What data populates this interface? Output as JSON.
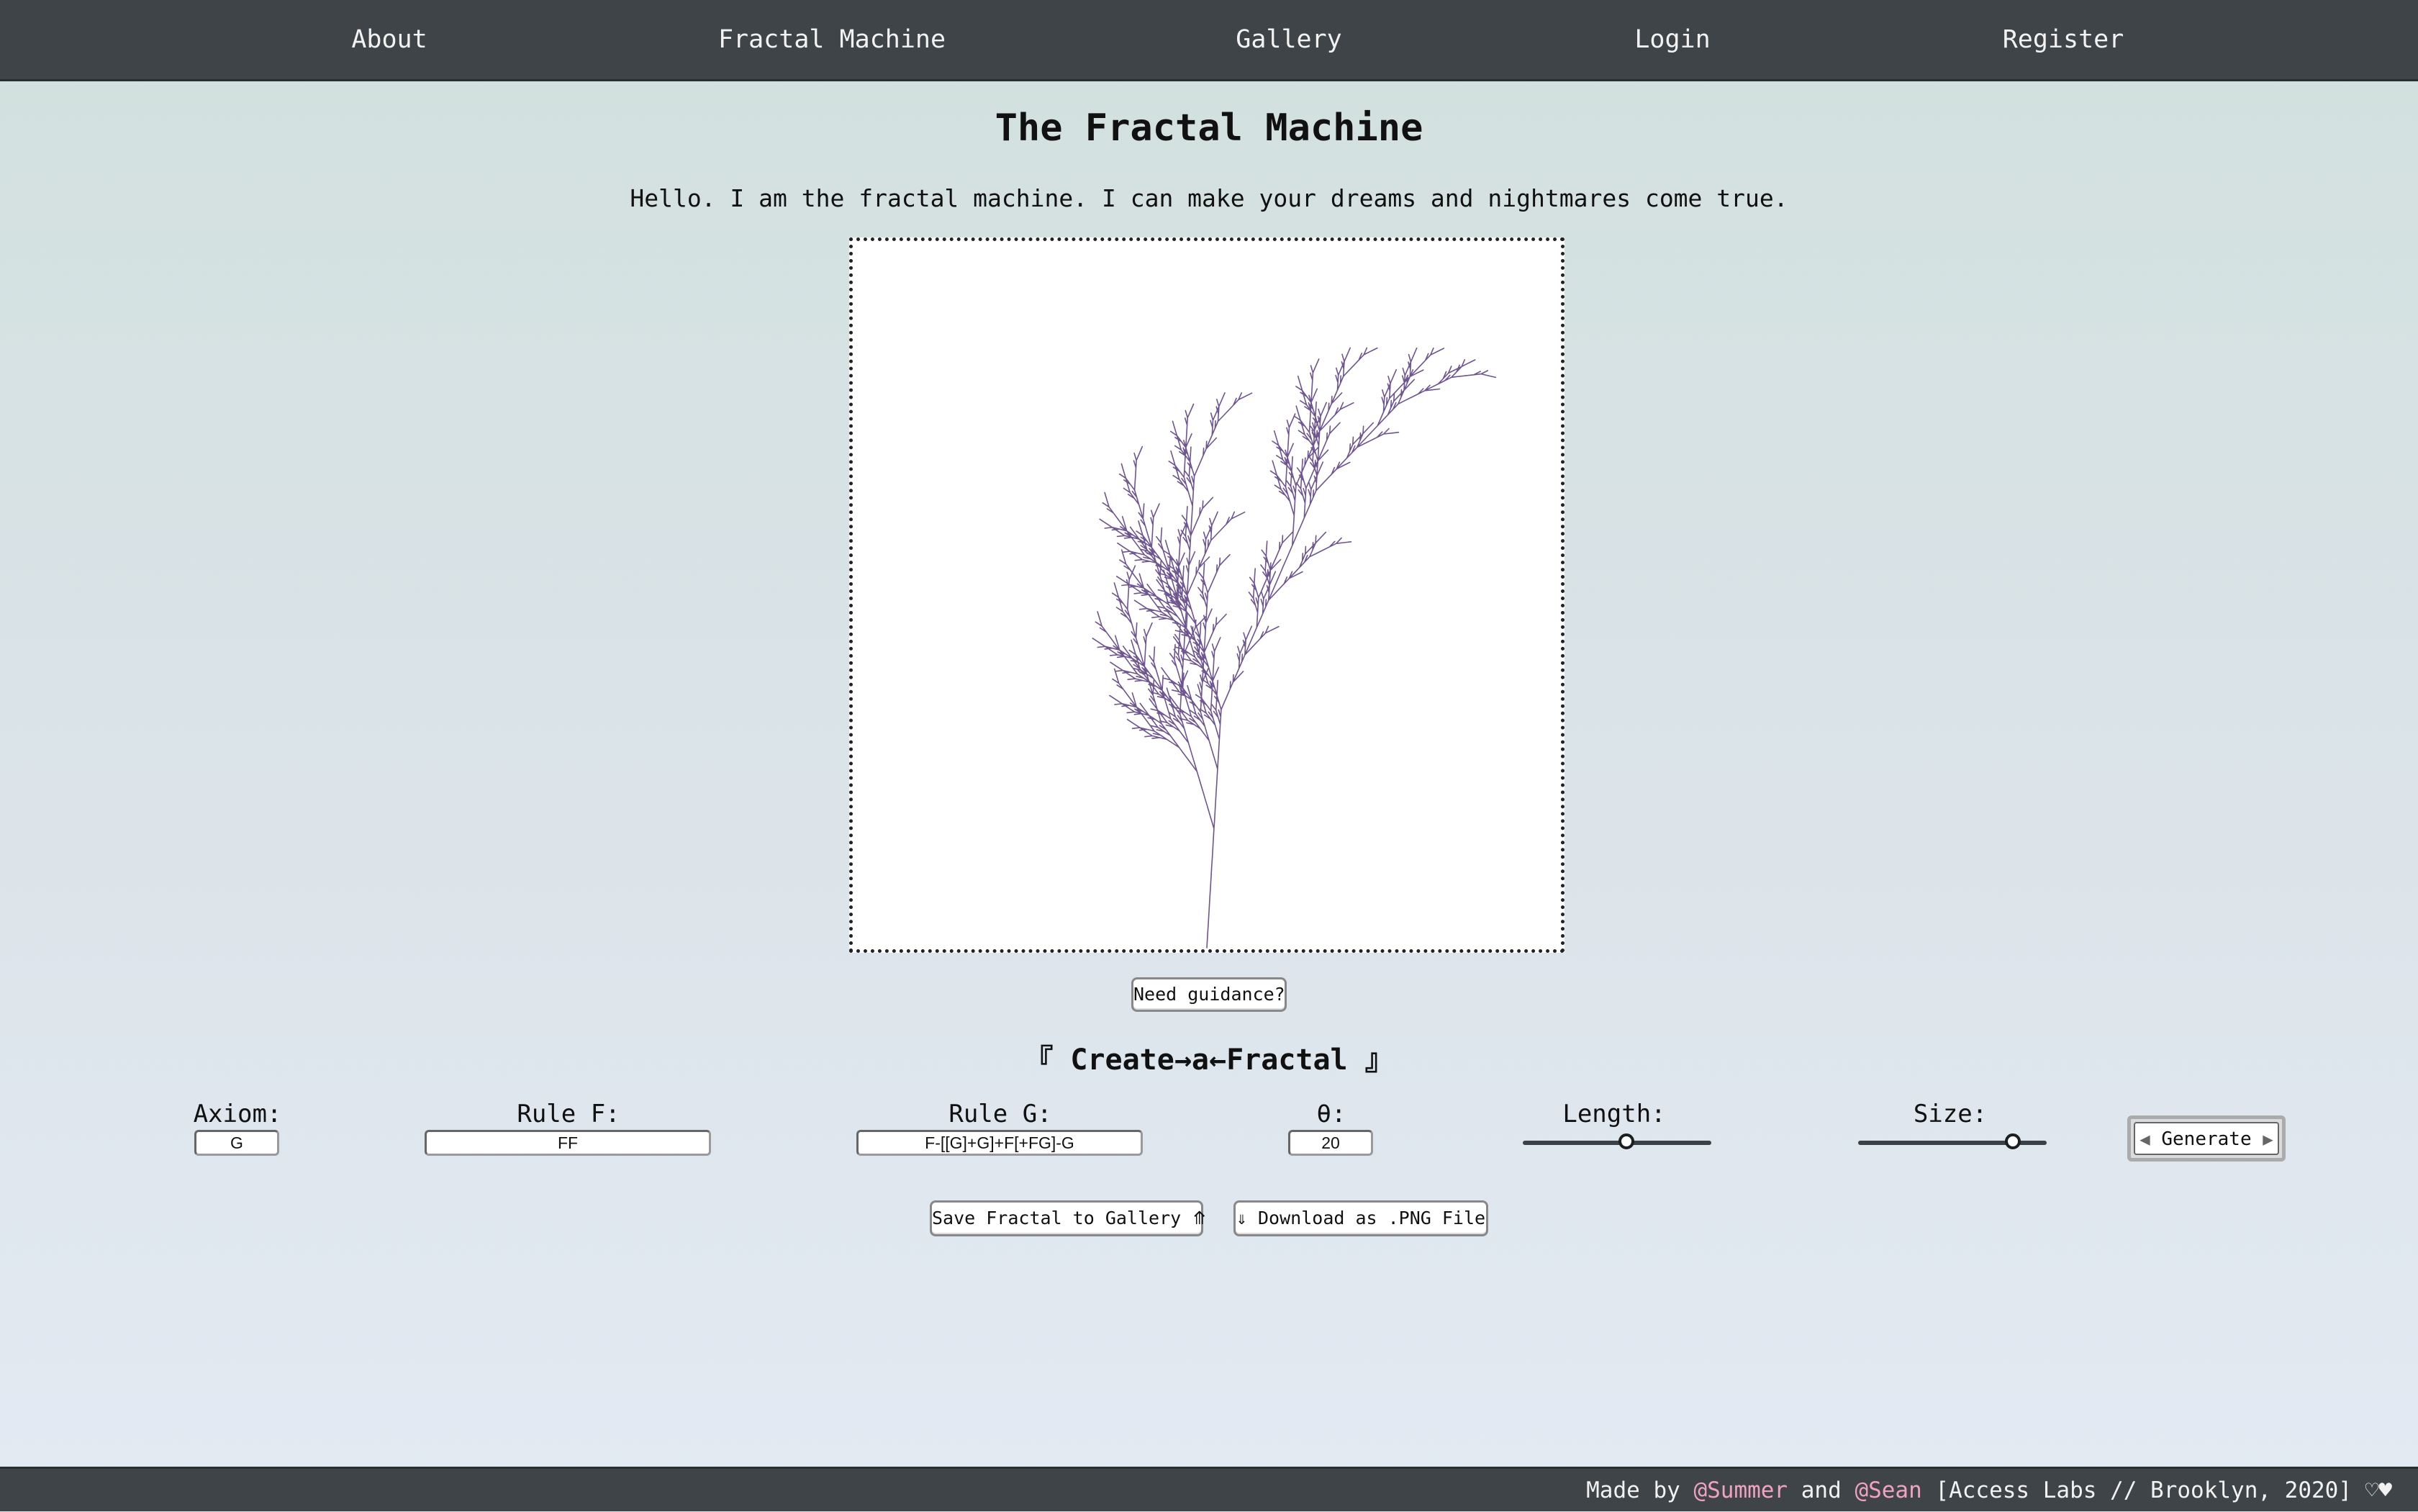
{
  "nav": {
    "items": [
      {
        "label": "About"
      },
      {
        "label": "Fractal Machine"
      },
      {
        "label": "Gallery"
      },
      {
        "label": "Login"
      },
      {
        "label": "Register"
      }
    ]
  },
  "main": {
    "title": "The Fractal Machine",
    "intro": "Hello. I am the fractal machine. I can make your dreams and nightmares come true.",
    "guidance_label": "Need guidance?",
    "create_heading": "『 Create→a←Fractal 』"
  },
  "controls": {
    "axiom_label": "Axiom:",
    "axiom_value": "G",
    "rule_f_label": "Rule F:",
    "rule_f_value": "FF",
    "rule_g_label": "Rule G:",
    "rule_g_value": "F-[[G]+G]+F[+FG]-G",
    "theta_label": "θ:",
    "theta_value": "20",
    "length_label": "Length:",
    "length_level": 0.55,
    "size_label": "Size:",
    "size_level": 0.82,
    "generate_label": "Generate",
    "generate_left_icon": "triangle-left-icon",
    "generate_right_icon": "triangle-right-icon"
  },
  "actions": {
    "save_label": "Save Fractal to Gallery ⤊",
    "download_label": "⇓ Download as .PNG File"
  },
  "footer": {
    "prefix": "Made by ",
    "author1": "@Summer",
    "mid": " and ",
    "author2": "@Sean",
    "suffix": " [Access Labs // Brooklyn, 2020] ♡♥"
  },
  "colors": {
    "fractal": "#6e5590",
    "nav_bg": "#3f4448",
    "footer_link": "#f0a3c0"
  }
}
